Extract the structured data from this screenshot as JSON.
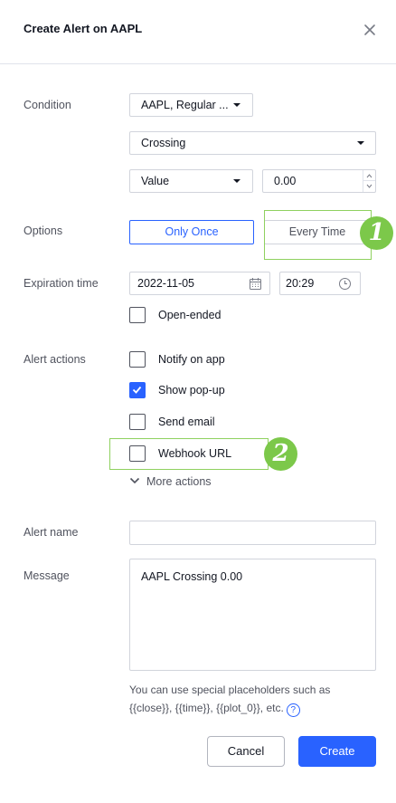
{
  "dialog": {
    "title": "Create Alert on AAPL"
  },
  "condition": {
    "label": "Condition",
    "source": "AAPL, Regular ...",
    "operator": "Crossing",
    "target_type": "Value",
    "target_value": "0.00"
  },
  "options": {
    "label": "Options",
    "only_once": "Only Once",
    "every_time": "Every Time",
    "selected": "Only Once"
  },
  "expiration": {
    "label": "Expiration time",
    "date": "2022-11-05",
    "time": "20:29",
    "open_ended": "Open-ended"
  },
  "alert_actions": {
    "label": "Alert actions",
    "items": [
      {
        "label": "Notify on app",
        "checked": false
      },
      {
        "label": "Show pop-up",
        "checked": true
      },
      {
        "label": "Send email",
        "checked": false
      },
      {
        "label": "Webhook URL",
        "checked": false
      }
    ],
    "more": "More actions"
  },
  "alert_name": {
    "label": "Alert name",
    "value": ""
  },
  "message": {
    "label": "Message",
    "value": "AAPL Crossing 0.00"
  },
  "hint": {
    "line1": "You can use special placeholders such as",
    "line2": "{{close}}, {{time}}, {{plot_0}}, etc."
  },
  "annotations": {
    "badge1": "1",
    "badge2": "2",
    "color": "#7cc84a"
  },
  "footer": {
    "cancel": "Cancel",
    "create": "Create"
  },
  "colors": {
    "accent": "#2962ff",
    "text": "#131722",
    "muted": "#50535e",
    "border": "#d1d4dc"
  }
}
